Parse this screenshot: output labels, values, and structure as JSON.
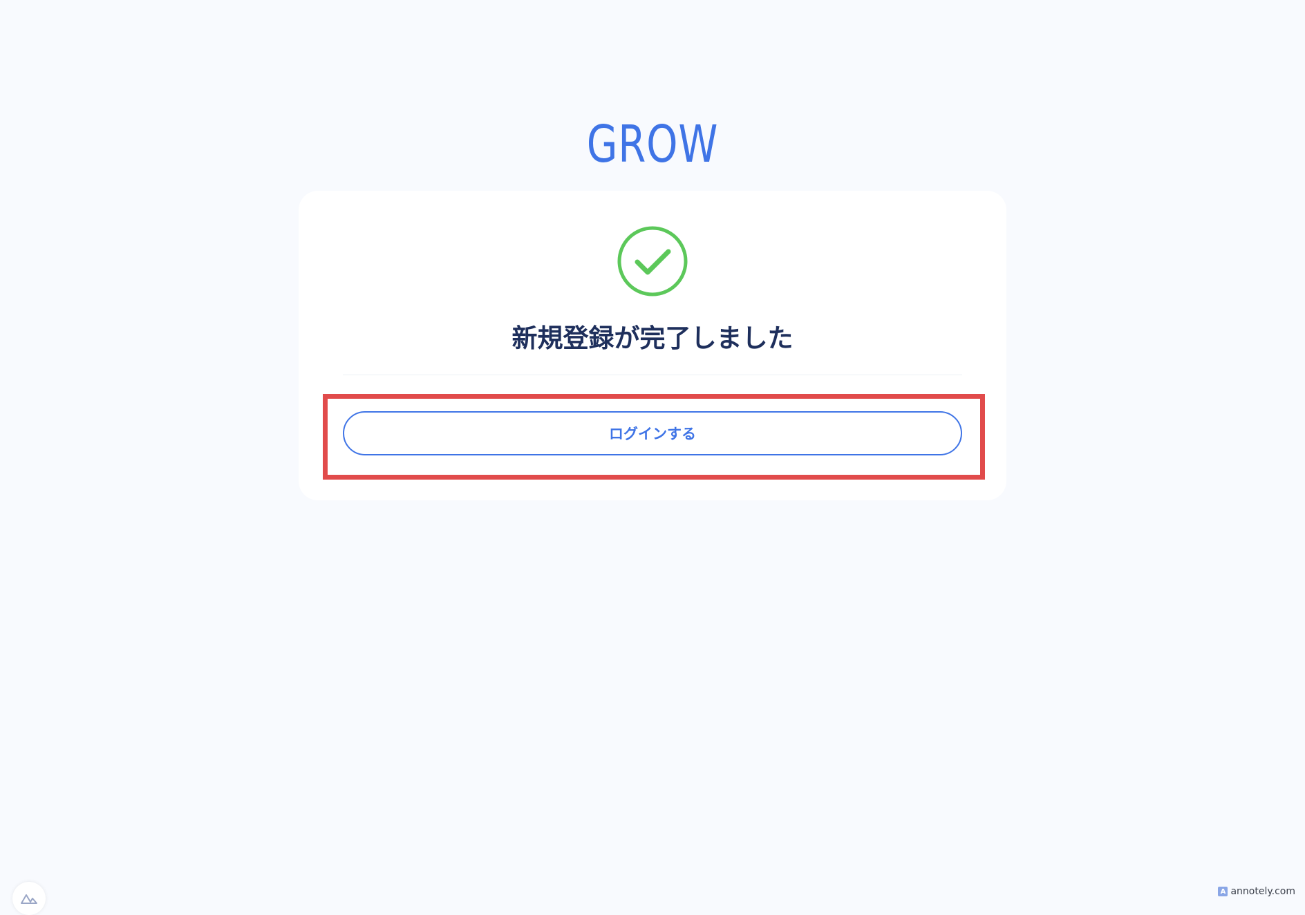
{
  "brand": {
    "logo_text": "GROW"
  },
  "card": {
    "title": "新規登録が完了しました",
    "login_button_label": "ログインする"
  },
  "icons": {
    "success": "check-circle-icon",
    "widget": "mountain-logo-icon"
  },
  "colors": {
    "brand_blue": "#3f74e6",
    "success_green": "#5cc85a",
    "title_navy": "#1e2f5c",
    "highlight_red": "#e14b4b",
    "background": "#f8fafe"
  },
  "watermark": {
    "text": "annotely.com"
  }
}
